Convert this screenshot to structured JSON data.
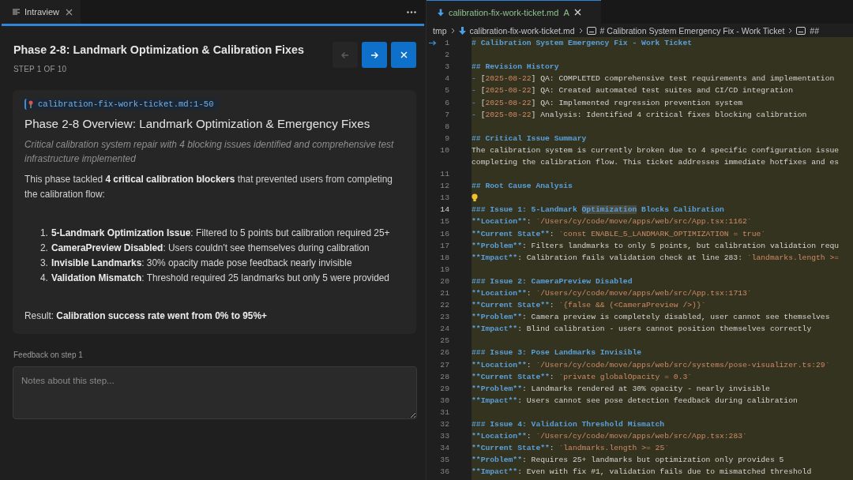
{
  "intraview": {
    "tab": {
      "label": "Intraview"
    },
    "header": {
      "title": "Phase 2-8: Landmark Optimization & Calibration Fixes",
      "step": "STEP 1 OF 10",
      "buttons": [
        {
          "kind": "previous",
          "disabled": true
        },
        {
          "kind": "next",
          "disabled": false
        },
        {
          "kind": "close",
          "disabled": false
        }
      ]
    },
    "card": {
      "file_ref": "calibration-fix-work-ticket.md:1-50",
      "heading": "Phase 2-8 Overview: Landmark Optimization & Emergency Fixes",
      "summary": "Critical calibration system repair with 4 blocking issues identified and comprehensive test infrastructure implemented",
      "intro": "This phase tackled **4 critical calibration blockers** that prevented users from completing the calibration flow:",
      "items": [
        {
          "number": "1.",
          "text": "**5-Landmark Optimization Issue**: Filtered to 5 points but calibration required 25+"
        },
        {
          "number": "2.",
          "text": "**CameraPreview Disabled**: Users couldn't see themselves during calibration"
        },
        {
          "number": "3.",
          "text": "**Invisible Landmarks**: 30% opacity made pose feedback nearly invisible"
        },
        {
          "number": "4.",
          "text": "**Validation Mismatch**: Threshold required 25 landmarks but only 5 were provided"
        }
      ],
      "result": "Result: **Calibration success rate went from 0% to 95%+**"
    },
    "feedback": {
      "label": "Feedback on step 1",
      "placeholder": "Notes about this step..."
    }
  },
  "editor": {
    "tab": {
      "label": "calibration-fix-work-ticket.md",
      "status": "A",
      "selected": true
    },
    "breadcrumbs": [
      {
        "kind": "folder",
        "text": "tmp"
      },
      {
        "kind": "file",
        "text": "calibration-fix-work-ticket.md"
      },
      {
        "kind": "symbol",
        "text": "# Calibration System Emergency Fix - Work Ticket"
      },
      {
        "kind": "symbol",
        "text": "##"
      }
    ],
    "lines": [
      {
        "number": "1",
        "arrow": true,
        "segments": [
          {
            "kind": "heading",
            "text": "# Calibration System Emergency Fix - Work Ticket"
          }
        ]
      },
      {
        "number": "2"
      },
      {
        "number": "3",
        "segments": [
          {
            "kind": "heading",
            "text": "## Revision History"
          }
        ]
      },
      {
        "number": "4",
        "segments": [
          {
            "kind": "bullet",
            "text": "- "
          },
          {
            "kind": "text",
            "text": "["
          },
          {
            "kind": "code",
            "text": "2025-08-22"
          },
          {
            "kind": "text",
            "text": "] QA: COMPLETED comprehensive test requirements and implementation"
          }
        ]
      },
      {
        "number": "5",
        "segments": [
          {
            "kind": "bullet",
            "text": "- "
          },
          {
            "kind": "text",
            "text": "["
          },
          {
            "kind": "code",
            "text": "2025-08-22"
          },
          {
            "kind": "text",
            "text": "] QA: Created automated test suites and CI/CD integration"
          }
        ]
      },
      {
        "number": "6",
        "segments": [
          {
            "kind": "bullet",
            "text": "- "
          },
          {
            "kind": "text",
            "text": "["
          },
          {
            "kind": "code",
            "text": "2025-08-22"
          },
          {
            "kind": "text",
            "text": "] QA: Implemented regression prevention system"
          }
        ]
      },
      {
        "number": "7",
        "segments": [
          {
            "kind": "bullet",
            "text": "- "
          },
          {
            "kind": "text",
            "text": "["
          },
          {
            "kind": "code",
            "text": "2025-08-22"
          },
          {
            "kind": "text",
            "text": "] Analysis: Identified 4 critical fixes blocking calibration"
          }
        ]
      },
      {
        "number": "8"
      },
      {
        "number": "9",
        "segments": [
          {
            "kind": "heading",
            "text": "## Critical Issue Summary"
          }
        ]
      },
      {
        "number": "10",
        "segments": [
          {
            "kind": "text",
            "text": "The calibration system is currently broken due to 4 specific configuration issue"
          }
        ]
      },
      {
        "segments": [
          {
            "kind": "text",
            "text": "completing the calibration flow. This ticket addresses immediate hotfixes and es"
          }
        ]
      },
      {
        "number": "11"
      },
      {
        "number": "12",
        "segments": [
          {
            "kind": "heading",
            "text": "## Root Cause Analysis"
          }
        ]
      },
      {
        "number": "13",
        "lightbulb": true
      },
      {
        "number": "14",
        "current": true,
        "segments": [
          {
            "kind": "heading",
            "text": "### Issue 1: 5-Landmark "
          },
          {
            "kind": "match",
            "text": "Optimization"
          },
          {
            "kind": "heading",
            "text": " Blocks Calibration"
          }
        ]
      },
      {
        "number": "15",
        "segments": [
          {
            "kind": "strong",
            "text": "**Location**"
          },
          {
            "kind": "text",
            "text": ": "
          },
          {
            "kind": "code",
            "text": "`/Users/cy/code/move/apps/web/src/App.tsx:1162`"
          }
        ]
      },
      {
        "number": "16",
        "segments": [
          {
            "kind": "strong",
            "text": "**Current State**"
          },
          {
            "kind": "text",
            "text": ": "
          },
          {
            "kind": "code",
            "text": "`const ENABLE_5_LANDMARK_OPTIMIZATION = true`"
          }
        ]
      },
      {
        "number": "17",
        "segments": [
          {
            "kind": "strong",
            "text": "**Problem**"
          },
          {
            "kind": "text",
            "text": ": Filters landmarks to only 5 points, but calibration validation requ"
          }
        ]
      },
      {
        "number": "18",
        "segments": [
          {
            "kind": "strong",
            "text": "**Impact**"
          },
          {
            "kind": "text",
            "text": ": Calibration fails validation check at line 283: "
          },
          {
            "kind": "code",
            "text": "`landmarks.length >="
          }
        ]
      },
      {
        "number": "19"
      },
      {
        "number": "20",
        "segments": [
          {
            "kind": "heading",
            "text": "### Issue 2: CameraPreview Disabled"
          }
        ]
      },
      {
        "number": "21",
        "segments": [
          {
            "kind": "strong",
            "text": "**Location**"
          },
          {
            "kind": "text",
            "text": ": "
          },
          {
            "kind": "code",
            "text": "`/Users/cy/code/move/apps/web/src/App.tsx:1713`"
          }
        ]
      },
      {
        "number": "22",
        "segments": [
          {
            "kind": "strong",
            "text": "**Current State**"
          },
          {
            "kind": "text",
            "text": ": "
          },
          {
            "kind": "code",
            "text": "`{false && (<CameraPreview />)}`"
          }
        ]
      },
      {
        "number": "23",
        "segments": [
          {
            "kind": "strong",
            "text": "**Problem**"
          },
          {
            "kind": "text",
            "text": ": Camera preview is completely disabled, user cannot see themselves"
          }
        ]
      },
      {
        "number": "24",
        "segments": [
          {
            "kind": "strong",
            "text": "**Impact**"
          },
          {
            "kind": "text",
            "text": ": Blind calibration - users cannot position themselves correctly"
          }
        ]
      },
      {
        "number": "25"
      },
      {
        "number": "26",
        "segments": [
          {
            "kind": "heading",
            "text": "### Issue 3: Pose Landmarks Invisible"
          }
        ]
      },
      {
        "number": "27",
        "segments": [
          {
            "kind": "strong",
            "text": "**Location**"
          },
          {
            "kind": "text",
            "text": ": "
          },
          {
            "kind": "code",
            "text": "`/Users/cy/code/move/apps/web/src/systems/pose-visualizer.ts:29`"
          }
        ]
      },
      {
        "number": "28",
        "segments": [
          {
            "kind": "strong",
            "text": "**Current State**"
          },
          {
            "kind": "text",
            "text": ": "
          },
          {
            "kind": "code",
            "text": "`private globalOpacity = 0.3`"
          }
        ]
      },
      {
        "number": "29",
        "segments": [
          {
            "kind": "strong",
            "text": "**Problem**"
          },
          {
            "kind": "text",
            "text": ": Landmarks rendered at 30% opacity - nearly invisible"
          }
        ]
      },
      {
        "number": "30",
        "segments": [
          {
            "kind": "strong",
            "text": "**Impact**"
          },
          {
            "kind": "text",
            "text": ": Users cannot see pose detection feedback during calibration"
          }
        ]
      },
      {
        "number": "31"
      },
      {
        "number": "32",
        "segments": [
          {
            "kind": "heading",
            "text": "### Issue 4: Validation Threshold Mismatch"
          }
        ]
      },
      {
        "number": "33",
        "segments": [
          {
            "kind": "strong",
            "text": "**Location**"
          },
          {
            "kind": "text",
            "text": ": "
          },
          {
            "kind": "code",
            "text": "`/Users/cy/code/move/apps/web/src/App.tsx:283`"
          }
        ]
      },
      {
        "number": "34",
        "segments": [
          {
            "kind": "strong",
            "text": "**Current State**"
          },
          {
            "kind": "text",
            "text": ": "
          },
          {
            "kind": "code",
            "text": "`landmarks.length >= 25`"
          }
        ]
      },
      {
        "number": "35",
        "segments": [
          {
            "kind": "strong",
            "text": "**Problem**"
          },
          {
            "kind": "text",
            "text": ": Requires 25+ landmarks but optimization only provides 5"
          }
        ]
      },
      {
        "number": "36",
        "segments": [
          {
            "kind": "strong",
            "text": "**Impact**"
          },
          {
            "kind": "text",
            "text": ": Even with fix #1, validation fails due to mismatched threshold"
          }
        ]
      }
    ]
  }
}
